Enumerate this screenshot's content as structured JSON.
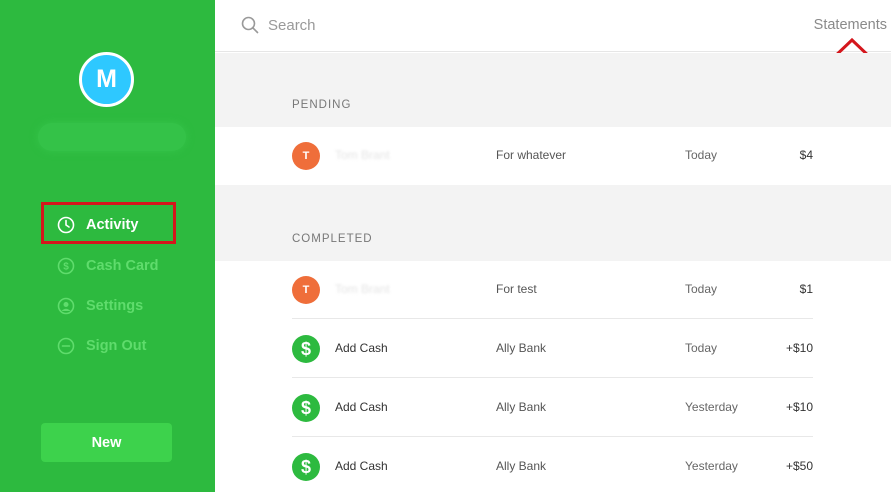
{
  "sidebar": {
    "avatar_initial": "M",
    "nav": [
      {
        "label": "Activity",
        "icon": "clock-icon",
        "active": true
      },
      {
        "label": "Cash Card",
        "icon": "dollar-circle-icon",
        "active": false
      },
      {
        "label": "Settings",
        "icon": "user-circle-icon",
        "active": false
      },
      {
        "label": "Sign Out",
        "icon": "minus-circle-icon",
        "active": false
      }
    ],
    "new_button": "New"
  },
  "topbar": {
    "search_placeholder": "Search",
    "statements_label": "Statements"
  },
  "pending": {
    "label": "PENDING",
    "rows": [
      {
        "avatar": "T",
        "avatar_color": "#ef6e3a",
        "who": "Tom Brant",
        "note": "For whatever",
        "when": "Today",
        "amount": "$4"
      }
    ]
  },
  "completed": {
    "label": "COMPLETED",
    "rows": [
      {
        "avatar": "T",
        "avatar_color": "#ef6e3a",
        "who": "Tom Brant",
        "note": "For test",
        "when": "Today",
        "amount": "$1"
      },
      {
        "avatar": "$",
        "avatar_color": "#2dba3f",
        "who": "Add Cash",
        "note": "Ally Bank",
        "when": "Today",
        "amount": "+$10"
      },
      {
        "avatar": "$",
        "avatar_color": "#2dba3f",
        "who": "Add Cash",
        "note": "Ally Bank",
        "when": "Yesterday",
        "amount": "+$10"
      },
      {
        "avatar": "$",
        "avatar_color": "#2dba3f",
        "who": "Add Cash",
        "note": "Ally Bank",
        "when": "Yesterday",
        "amount": "+$50"
      }
    ]
  },
  "colors": {
    "sidebar": "#2dba3f",
    "new_button": "#3dd24c",
    "annotation_red": "#d4161c"
  }
}
